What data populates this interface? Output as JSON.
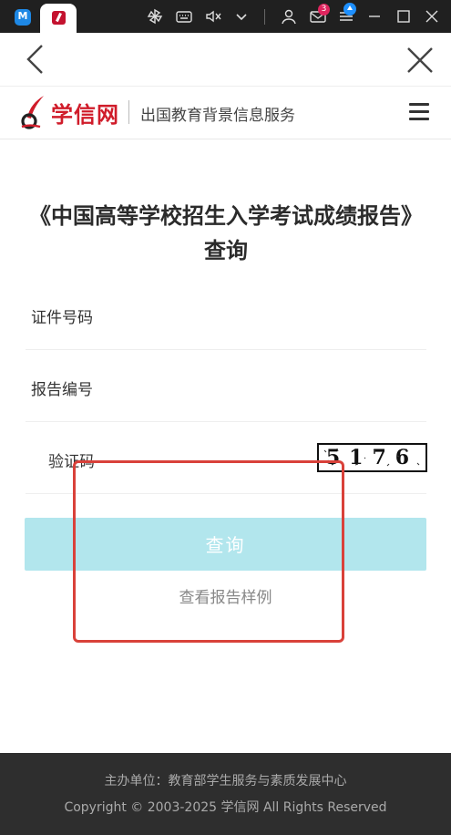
{
  "taskbar": {
    "notification_count": "3"
  },
  "site": {
    "logo_text": "学信网",
    "subtitle": "出国教育背景信息服务"
  },
  "page": {
    "title": "《中国高等学校招生入学考试成绩报告》查询"
  },
  "form": {
    "id_label": "证件号码",
    "id_value": "",
    "report_label": "报告编号",
    "report_value": "",
    "captcha_label": "验证码",
    "captcha_value": "",
    "captcha_text": "5176"
  },
  "actions": {
    "query_label": "查询",
    "sample_label": "查看报告样例"
  },
  "footer": {
    "organizer": "主办单位：教育部学生服务与素质发展中心",
    "copyright": "Copyright © 2003-2025 学信网 All Rights Reserved"
  },
  "colors": {
    "brand_red": "#d01c2a",
    "button_bg": "#b2e6ed",
    "highlight_border": "#d9413a",
    "footer_bg": "#2e2e2e"
  }
}
